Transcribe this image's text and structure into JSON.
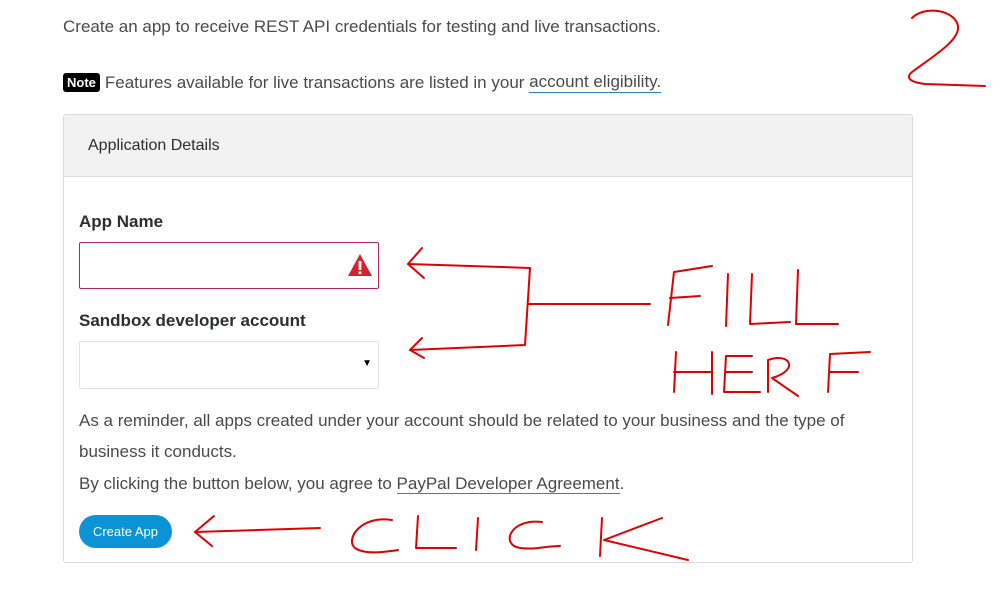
{
  "intro_text": "Create an app to receive REST API credentials for testing and live transactions.",
  "note": {
    "badge": "Note",
    "text": "Features available for live transactions are listed in your",
    "link": "account eligibility."
  },
  "card": {
    "header": "Application Details",
    "app_name": {
      "label": "App Name",
      "value": "",
      "status_icon": "warning-icon"
    },
    "sandbox": {
      "label": "Sandbox developer account",
      "selected": "",
      "arrow": "▼"
    },
    "reminder": "As a reminder, all apps created under your account should be related to your business and the type of business it conducts.",
    "agreement_prefix": "By clicking the button below, you agree to",
    "agreement_link": "PayPal Developer Agreement",
    "agreement_suffix": ".",
    "create_button": "Create App"
  },
  "annotations": {
    "color": "#e00000",
    "step_number": "2",
    "fill_text": [
      "FILL",
      "HERE"
    ],
    "click_text": "CLICK"
  }
}
